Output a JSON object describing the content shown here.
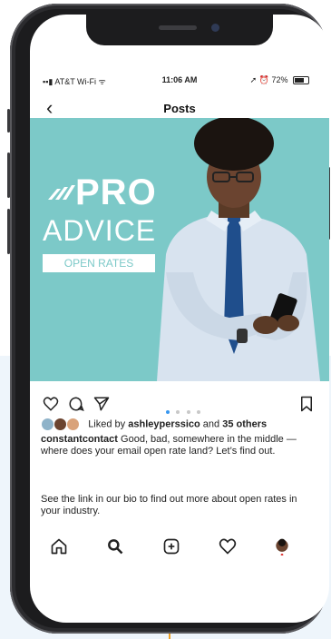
{
  "status_bar": {
    "carrier": "AT&T Wi-Fi",
    "time": "11:06 AM",
    "battery": "72%"
  },
  "nav": {
    "back_icon": "chevron-left-icon",
    "title": "Posts"
  },
  "post_graphic": {
    "headline": "PRO",
    "subheadline": "ADVICE",
    "tag": "OPEN RATES",
    "brand_color": "#7cc9c8"
  },
  "actions": {
    "like_icon": "heart-icon",
    "comment_icon": "comment-icon",
    "share_icon": "send-icon",
    "save_icon": "bookmark-icon",
    "carousel_dots": 4,
    "active_dot": 1,
    "accent": "#3897f0"
  },
  "likes": {
    "prefix": "Liked by",
    "user": "ashleyperssico",
    "middle": "and",
    "others": "35 others"
  },
  "caption": {
    "username": "constantcontact",
    "text": "Good, bad, somewhere in the middle — where does your email open rate land? Let’s find out.",
    "text2": "See the link in our bio to find out more about open rates in your industry."
  },
  "tabbar": {
    "home_icon": "home-icon",
    "search_icon": "search-icon",
    "add_icon": "add-post-icon",
    "activity_icon": "heart-icon",
    "profile_icon": "profile-avatar"
  }
}
